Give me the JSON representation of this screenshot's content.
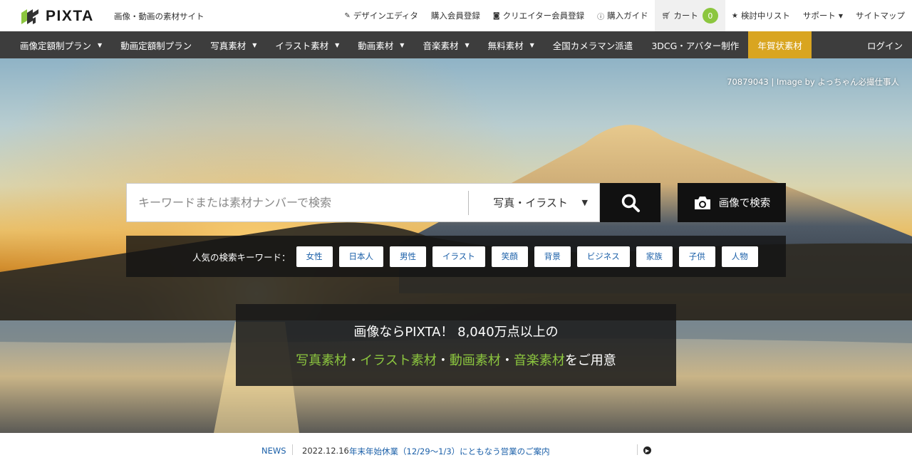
{
  "header": {
    "logo_text": "PIXTA",
    "tagline": "画像・動画の素材サイト",
    "links": [
      {
        "label": "デザインエディタ",
        "icon": "edit-icon"
      },
      {
        "label": "購入会員登録",
        "icon": ""
      },
      {
        "label": "クリエイター会員登録",
        "icon": "camera-icon"
      },
      {
        "label": "購入ガイド",
        "icon": "info-icon"
      }
    ],
    "cart": {
      "label": "カート",
      "count": "0",
      "icon": "cart-icon"
    },
    "favorites": {
      "label": "検討中リスト",
      "icon": "star-icon"
    },
    "support": {
      "label": "サポート"
    },
    "sitemap": {
      "label": "サイトマップ"
    }
  },
  "catnav": {
    "items": [
      {
        "label": "画像定額制プラン",
        "dropdown": true
      },
      {
        "label": "動画定額制プラン",
        "dropdown": false
      },
      {
        "label": "写真素材",
        "dropdown": true
      },
      {
        "label": "イラスト素材",
        "dropdown": true
      },
      {
        "label": "動画素材",
        "dropdown": true
      },
      {
        "label": "音楽素材",
        "dropdown": true
      },
      {
        "label": "無料素材",
        "dropdown": true
      },
      {
        "label": "全国カメラマン派遣",
        "dropdown": false
      },
      {
        "label": "3DCG・アバター制作",
        "dropdown": false
      },
      {
        "label": "年賀状素材",
        "dropdown": false,
        "highlight": true
      }
    ],
    "login": "ログイン"
  },
  "hero": {
    "credit_id": "70879043",
    "credit_sep": "|",
    "credit_text": "Image by よっちゃん必撮仕事人"
  },
  "search": {
    "placeholder": "キーワードまたは素材ナンバーで検索",
    "value": "",
    "type_selected": "写真・イラスト",
    "image_search_label": "画像で検索"
  },
  "popular": {
    "label": "人気の検索キーワード：",
    "keywords": [
      "女性",
      "日本人",
      "男性",
      "イラスト",
      "笑顔",
      "背景",
      "ビジネス",
      "家族",
      "子供",
      "人物"
    ]
  },
  "promo": {
    "line1": "画像ならPIXTA！ 8,040万点以上の",
    "photo": "写真素材",
    "dot": "・",
    "illust": "イラスト素材",
    "video": "動画素材",
    "music": "音楽素材",
    "suffix": "をご用意"
  },
  "news": {
    "label": "NEWS",
    "date": "2022.12.16",
    "title": "年末年始休業（12/29〜1/3）にともなう営業のご案内"
  },
  "colors": {
    "accent_green": "#8cc63f",
    "nav_bg": "#3d3d3d",
    "nav_highlight": "#d9a520",
    "link_blue": "#1a5fa8"
  }
}
